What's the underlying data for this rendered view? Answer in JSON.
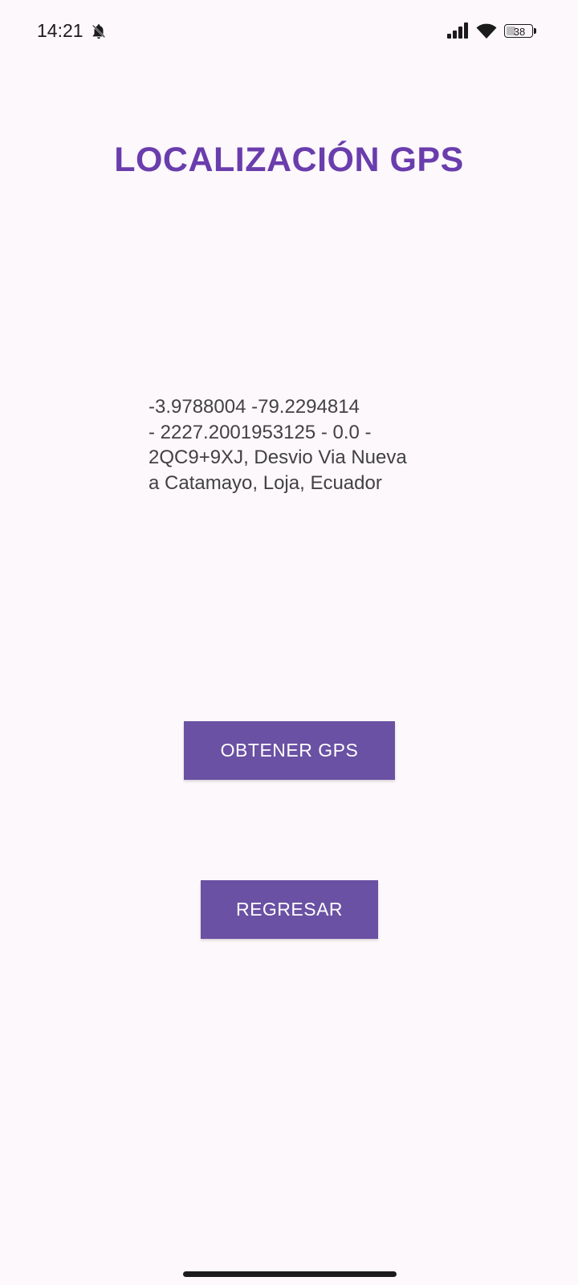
{
  "status_bar": {
    "time": "14:21",
    "battery_level": "38",
    "icons": [
      "bell-icon",
      "signal-icon",
      "wifi-icon",
      "battery-icon"
    ]
  },
  "page": {
    "title": "LOCALIZACIÓN GPS",
    "location_text": "-3.9788004 -79.2294814\n- 2227.2001953125 - 0.0 -\n2QC9+9XJ, Desvio Via Nueva\na Catamayo, Loja, Ecuador"
  },
  "buttons": {
    "get_gps_label": "OBTENER GPS",
    "back_label": "REGRESAR"
  },
  "colors": {
    "background": "#fdf8fc",
    "title": "#6a3dad",
    "button": "#6a51a3",
    "button_text": "#ffffff",
    "body_text": "#424242"
  }
}
